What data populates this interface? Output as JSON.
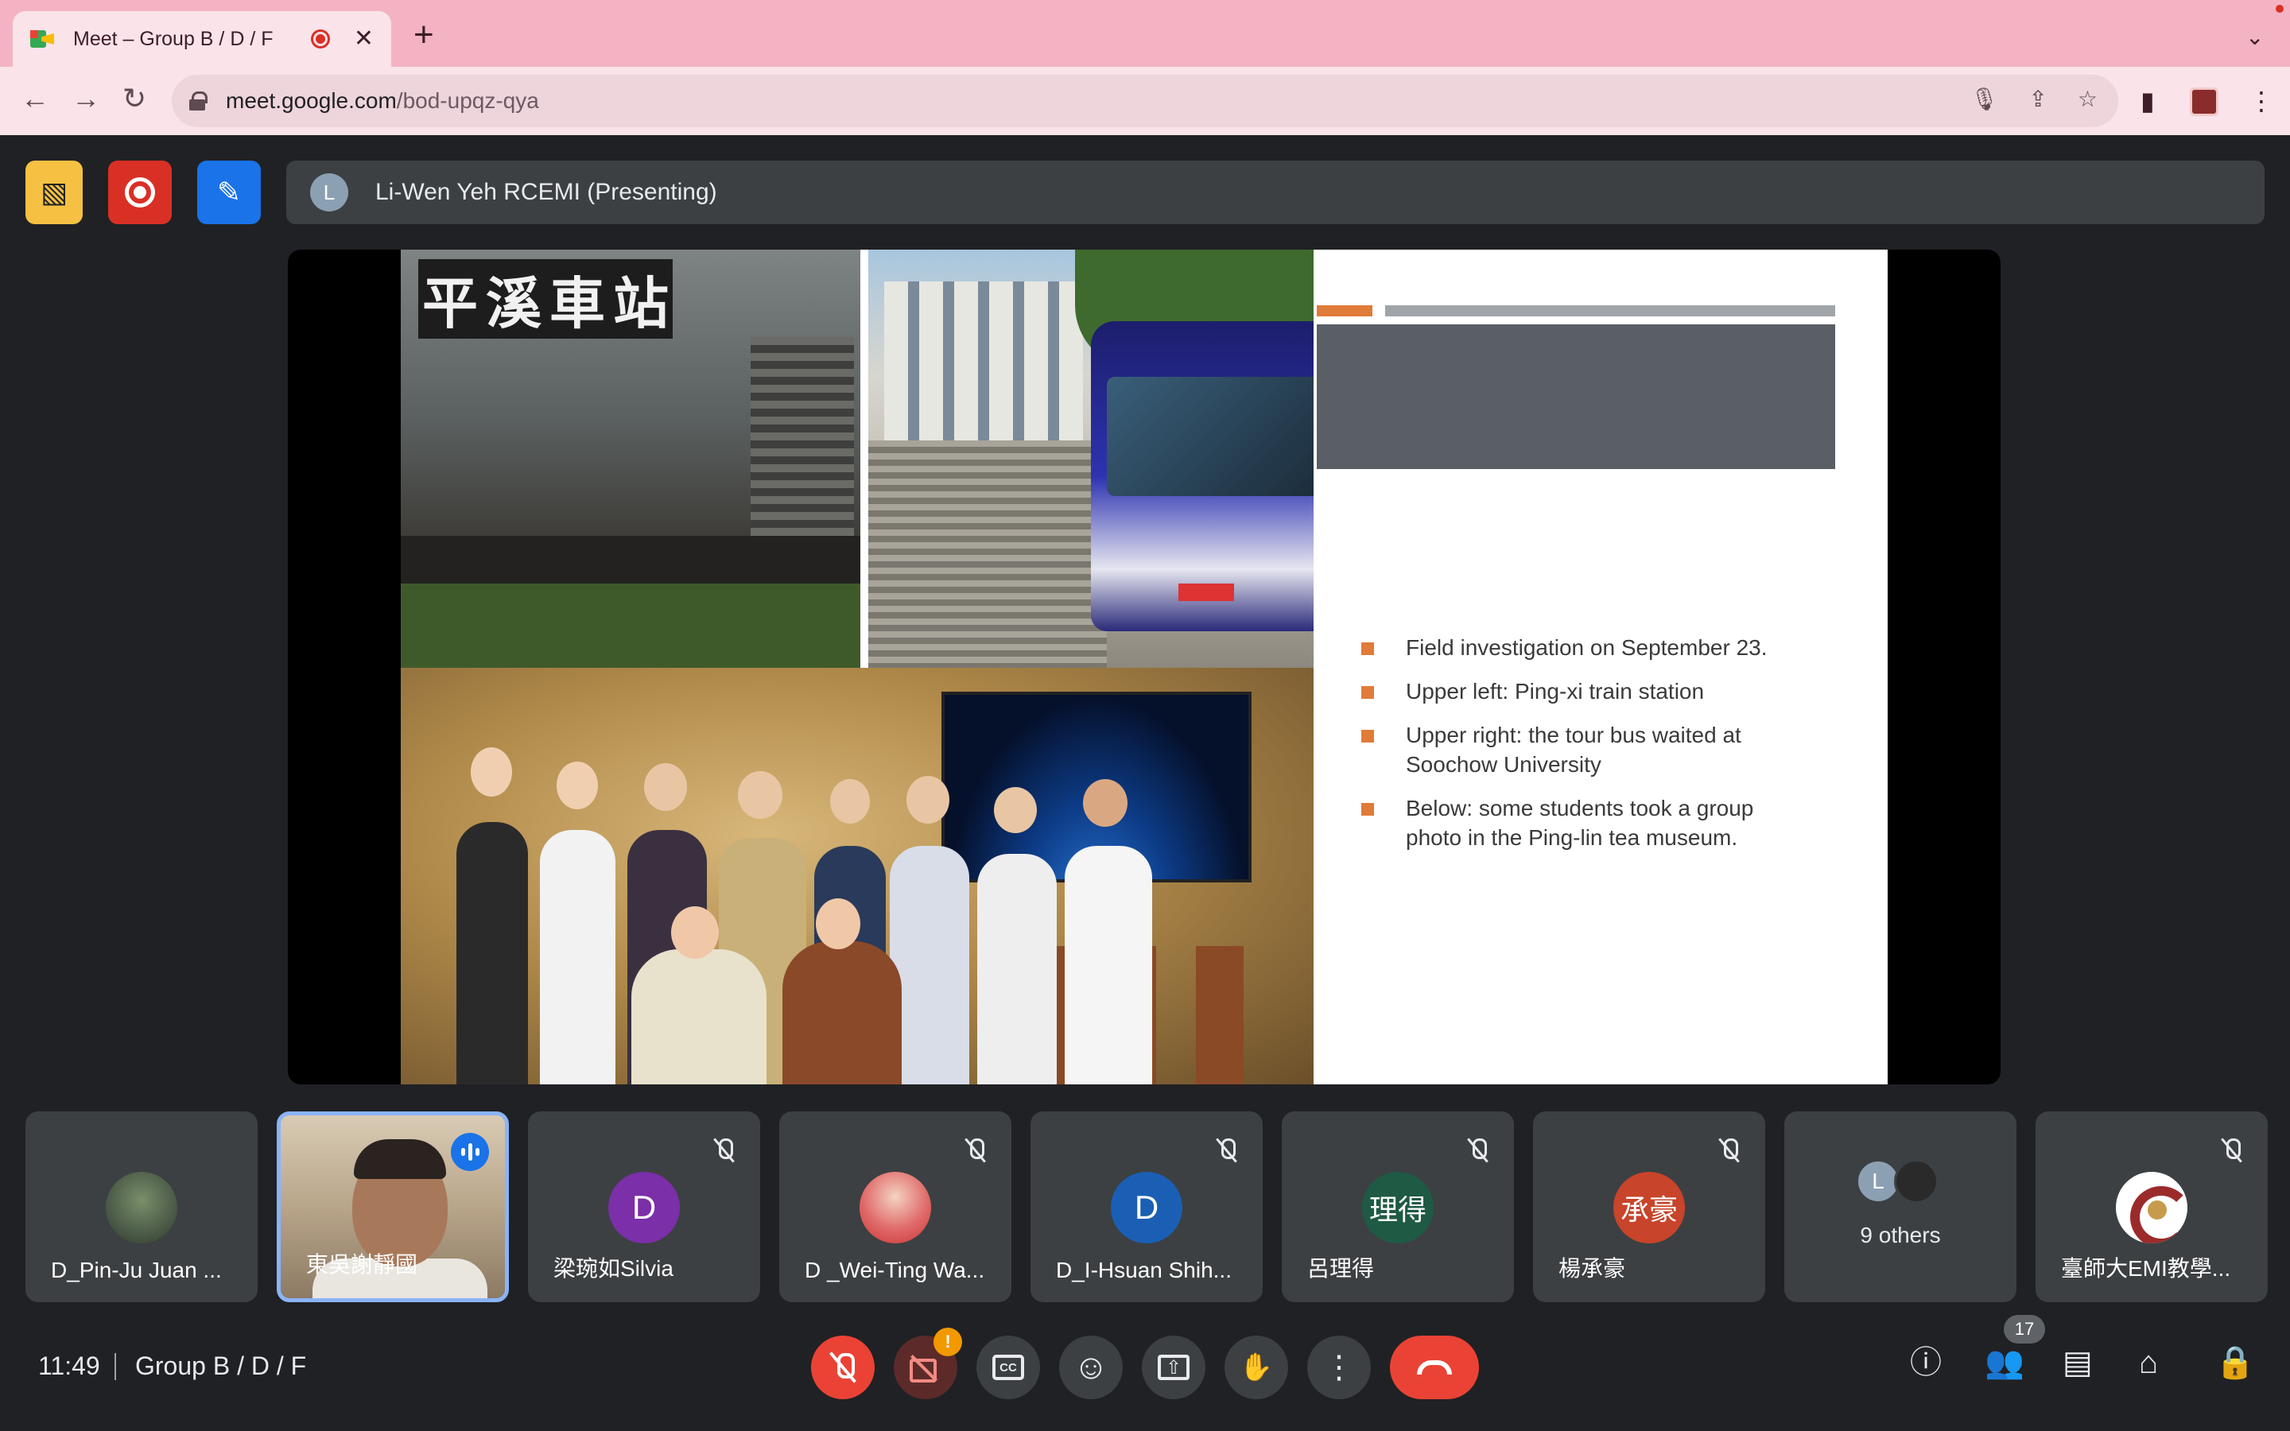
{
  "browser": {
    "tab_title": "Meet – Group B / D / F",
    "close_glyph": "✕",
    "newtab_glyph": "+",
    "dropdown_glyph": "⌄",
    "url_host": "meet.google.com",
    "url_path": "/bod-upqz-qya",
    "back_glyph": "←",
    "forward_glyph": "→",
    "reload_glyph": "↻",
    "mic_glyph": "🎙",
    "share_glyph": "⇪",
    "star_glyph": "☆",
    "sidepanel_glyph": "▮",
    "menu_glyph": "⋮"
  },
  "topbar": {
    "cc_glyph": "▧",
    "transcript_glyph": "✎",
    "presenter_initial": "L",
    "presenting_label": "Li-Wen Yeh RCEMI (Presenting)"
  },
  "slide": {
    "sign_chars": [
      "平",
      "溪",
      "車",
      "站"
    ],
    "bullets": [
      "Field investigation on September 23.",
      "Upper left: Ping-xi train station",
      "Upper right: the tour bus waited at Soochow University",
      "Below: some students took a group photo in the Ping-lin tea museum."
    ]
  },
  "participants": [
    {
      "name": "D_Pin-Ju Juan ...",
      "muted": false
    },
    {
      "name": "東吳謝靜國",
      "speaking": true
    },
    {
      "name": "梁琬如Silvia",
      "initial": "D",
      "color": "#7b2fa8",
      "muted": true
    },
    {
      "name": "D _Wei-Ting Wa...",
      "muted": true
    },
    {
      "name": "D_I-Hsuan Shih...",
      "initial": "D",
      "color": "#1a5fb4",
      "muted": true
    },
    {
      "name": "呂理得",
      "initial": "理得",
      "color": "#1f5a44",
      "muted": true
    },
    {
      "name": "楊承豪",
      "initial": "承豪",
      "color": "#c8442a",
      "muted": true
    },
    {
      "others_label": "9 others",
      "initial": "L"
    },
    {
      "name": "臺師大EMI教學...",
      "muted": true
    }
  ],
  "bottombar": {
    "time": "11:49",
    "meeting_name": "Group B / D / F",
    "cam_warning": "!",
    "cc_label": "CC",
    "emoji_glyph": "☺",
    "present_glyph": "⇧",
    "hand_glyph": "✋",
    "more_glyph": "⋮",
    "info_glyph": "ⓘ",
    "people_glyph": "👥",
    "people_count": "17",
    "chat_glyph": "▤",
    "activities_glyph": "⌂",
    "host_glyph": "🔒"
  },
  "colors": {
    "tabbar": "#f4b3c2",
    "accent_blue": "#1a73e8",
    "record_red": "#d93025",
    "bullet_orange": "#e07b39"
  }
}
